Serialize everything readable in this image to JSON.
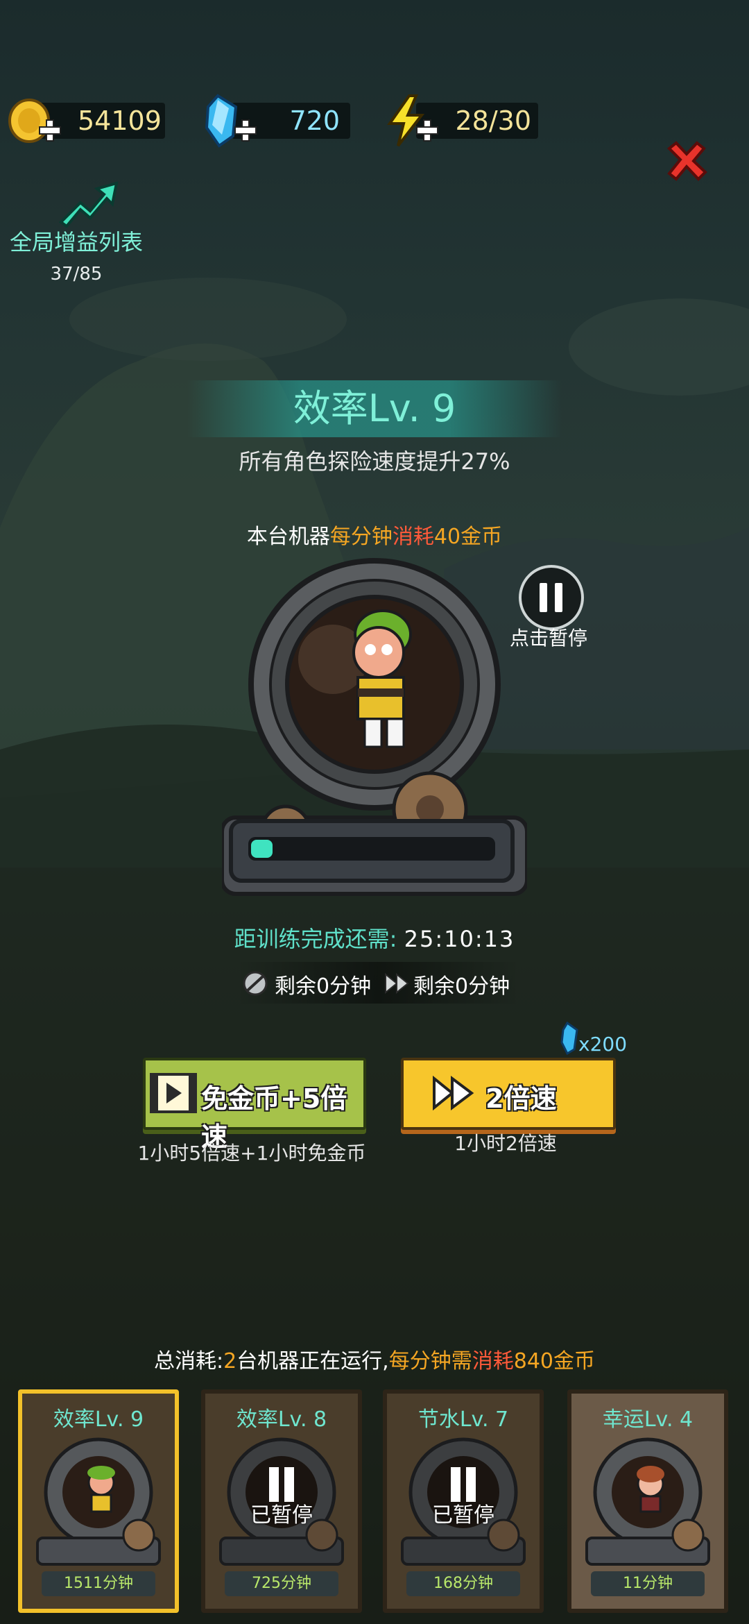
{
  "resources": {
    "gold": "54109",
    "gems": "720",
    "energy": "28/30"
  },
  "global_buff": {
    "label": "全局增益列表",
    "count": "37/85"
  },
  "machine": {
    "title": "效率Lv. 9",
    "effect": "所有角色探险速度提升27%",
    "cost_prefix": "本台机器",
    "cost_mid": "每分钟",
    "cost_red": "消耗",
    "cost_suffix": "40金币",
    "pause_label": "点击暂停",
    "progress_fraction": 0.09,
    "timer_label": "距训练完成还需:",
    "timer_value": "25:10:13",
    "free_remaining": "剩余0分钟",
    "speed_remaining": "剩余0分钟"
  },
  "actions": {
    "free_button": "免金币+5倍速",
    "free_desc": "1小时5倍速+1小时免金币",
    "speed_button": "2倍速",
    "speed_desc": "1小时2倍速",
    "speed_cost": "x200"
  },
  "summary": {
    "prefix": "总消耗:",
    "count": "2",
    "mid": "台机器正在运行,",
    "per_min": "每分钟需",
    "consume": "消耗",
    "amount": "840金币"
  },
  "cards": [
    {
      "title": "效率Lv. 9",
      "minutes": "1511分钟",
      "status": ""
    },
    {
      "title": "效率Lv. 8",
      "minutes": "725分钟",
      "status": "已暂停"
    },
    {
      "title": "节水Lv. 7",
      "minutes": "168分钟",
      "status": "已暂停"
    },
    {
      "title": "幸运Lv. 4",
      "minutes": "11分钟",
      "status": ""
    }
  ],
  "colors": {
    "accent_teal": "#5fe0c9",
    "orange": "#f5a623",
    "red": "#ff5a3a",
    "gold_text": "#f5e49a"
  }
}
